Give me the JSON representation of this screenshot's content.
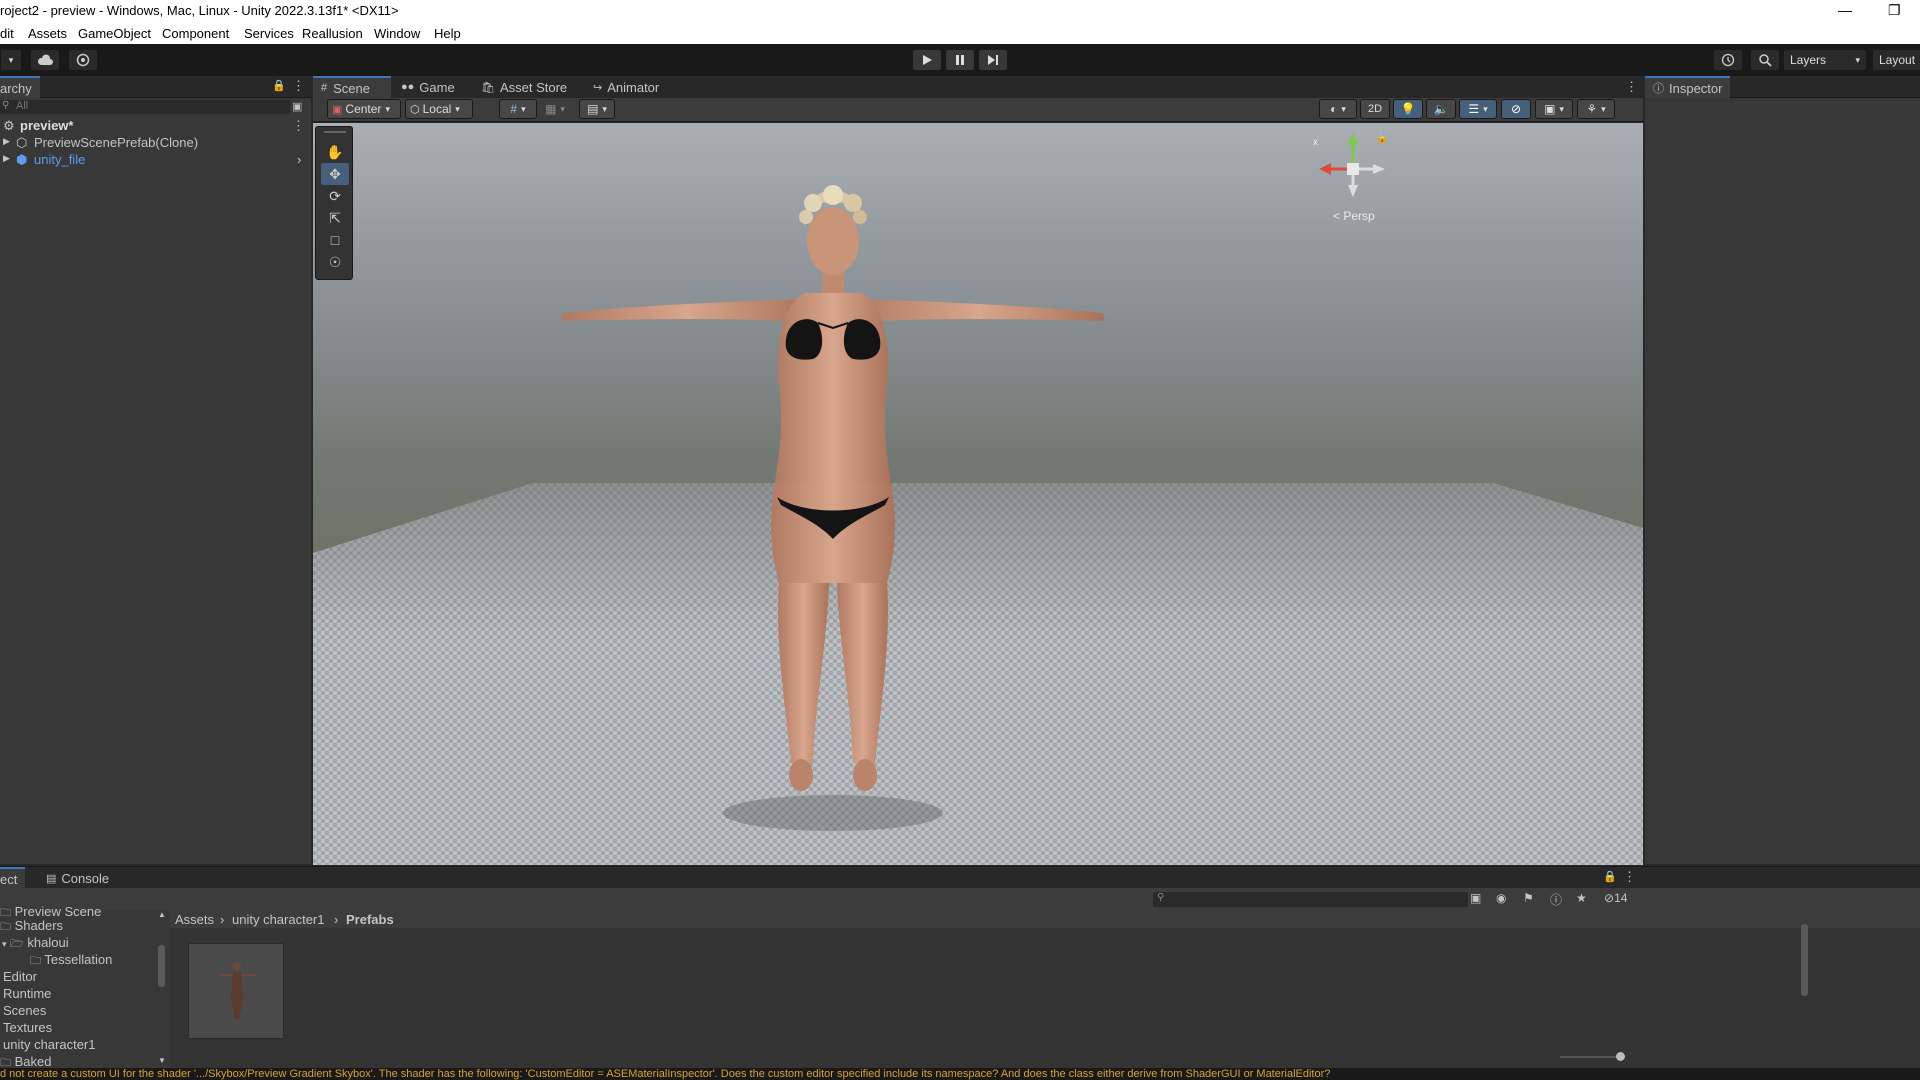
{
  "window": {
    "title": "roject2 - preview - Windows, Mac, Linux - Unity 2022.3.13f1* <DX11>"
  },
  "menu": [
    "dit",
    "Assets",
    "GameObject",
    "Component",
    "Services",
    "Reallusion",
    "Window",
    "Help"
  ],
  "toolbar": {
    "layers_label": "Layers",
    "layout_label": "Layout"
  },
  "hierarchy": {
    "tab_label": "archy",
    "search_placeholder": "All",
    "scene_name": "preview*",
    "items": [
      {
        "label": "PreviewScenePrefab(Clone)",
        "color": "#c4c4c4"
      },
      {
        "label": "unity_file",
        "color": "#5c9ded"
      }
    ]
  },
  "scene_tabs": [
    "Scene",
    "Game",
    "Asset Store",
    "Animator"
  ],
  "scene_toolbar": {
    "pivot": "Center",
    "space": "Local",
    "mode_2d": "2D"
  },
  "gizmo": {
    "projection": "Persp",
    "x_axis": "x"
  },
  "inspector": {
    "tab_label": "Inspector"
  },
  "bottom_tabs": [
    "ect",
    "Console"
  ],
  "project": {
    "hidden_count": "14",
    "tree": [
      {
        "label": "Preview Scene",
        "indent": 1
      },
      {
        "label": "Shaders",
        "indent": 0
      },
      {
        "label": "khaloui",
        "indent": 1
      },
      {
        "label": "Tessellation",
        "indent": 2
      },
      {
        "label": "Editor",
        "indent": 0
      },
      {
        "label": "Runtime",
        "indent": 0
      },
      {
        "label": "Scenes",
        "indent": 0
      },
      {
        "label": "Textures",
        "indent": 0
      },
      {
        "label": "unity character1",
        "indent": 0
      },
      {
        "label": "Baked",
        "indent": 0
      }
    ],
    "breadcrumb": [
      "Assets",
      "unity character1",
      "Prefabs"
    ]
  },
  "status": {
    "message": "d not create a custom UI for the shader '.../Skybox/Preview Gradient Skybox'. The shader has the following: 'CustomEditor = ASEMaterialInspector'. Does the custom editor specified include its namespace? And does the class either derive from ShaderGUI or MaterialEditor?"
  },
  "colors": {
    "accent": "#3a79bb",
    "warning": "#d8a235",
    "link_blue": "#5c9ded"
  }
}
